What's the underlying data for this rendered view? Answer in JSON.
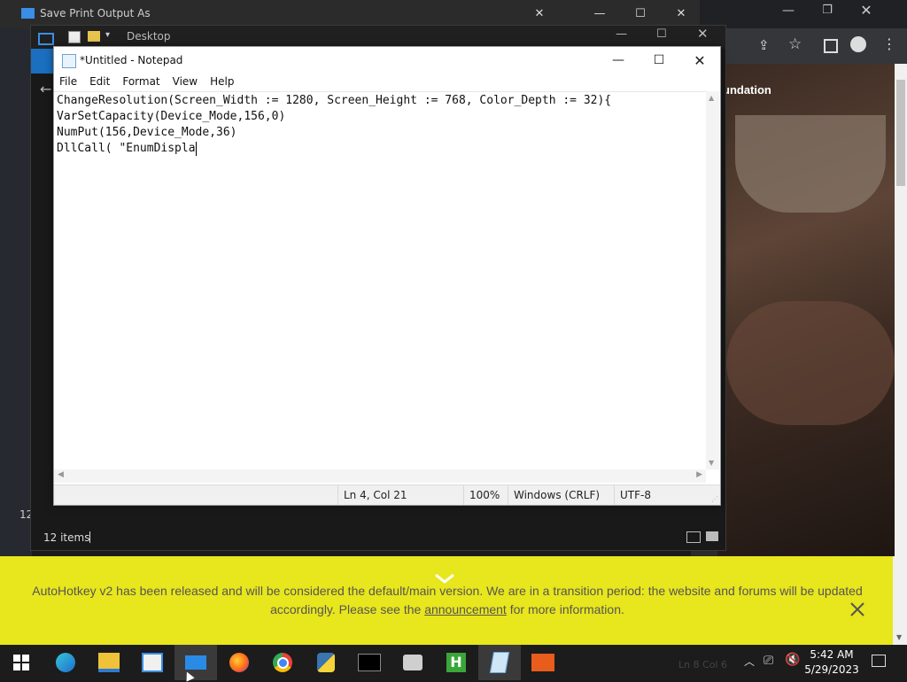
{
  "explorer": {
    "title": "Save Print Output As",
    "address": "Desktop",
    "status_items": "12 items",
    "side_count": "12"
  },
  "browser": {
    "banner_text": "undation"
  },
  "notepad": {
    "title": "*Untitled - Notepad",
    "menu": [
      "File",
      "Edit",
      "Format",
      "View",
      "Help"
    ],
    "lines": [
      "ChangeResolution(Screen_Width := 1280, Screen_Height := 768, Color_Depth := 32){",
      "VarSetCapacity(Device_Mode,156,0)",
      "NumPut(156,Device_Mode,36)",
      "DllCall( \"EnumDispla"
    ],
    "status": {
      "position": "Ln 4, Col 21",
      "zoom": "100%",
      "line_ending": "Windows (CRLF)",
      "encoding": "UTF-8"
    }
  },
  "notification": {
    "text_before": "AutoHotkey v2 has been released and will be considered the default/main version. We are in a transition period: the website and forums will be updated accordingly. Please see the ",
    "link": "announcement",
    "text_after": " for more information.",
    "bg_color": "#e8e61c"
  },
  "taskbar": {
    "ghost": "Ln 8   Col 6",
    "time": "5:42 AM",
    "date": "5/29/2023"
  }
}
